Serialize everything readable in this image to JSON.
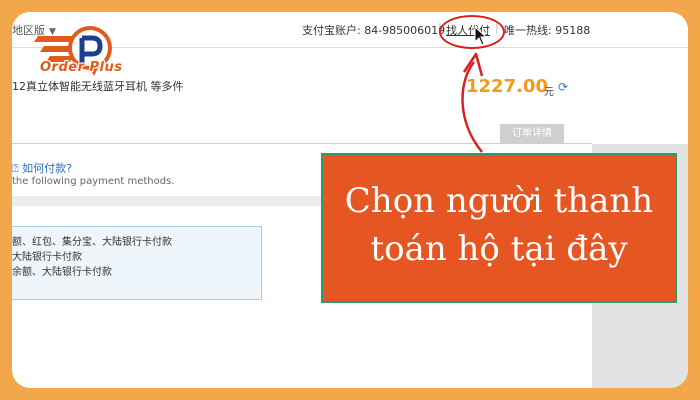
{
  "topbar": {
    "region_label": "地区版",
    "account_label": "支付宝账户: 84-985006019",
    "separator": "|",
    "payer_link": "找人代付",
    "hotline": "唯一热线: 95188"
  },
  "order": {
    "product_name": "12真立体智能无线蓝牙耳机 等多件",
    "price": "1227.00",
    "currency_unit": "元",
    "refresh_icon": "refresh-icon",
    "order_details_tab": "订单详情"
  },
  "payment": {
    "how_to_pay": "如何付款?",
    "methods_intro": "the following payment methods.",
    "methods": [
      "额、红包、集分宝、大陆银行卡付款",
      "大陆银行卡付款",
      "余额、大陆银行卡付款"
    ]
  },
  "callout": {
    "line1": "Chọn người thanh",
    "line2": "toán hộ tại đây"
  },
  "logo": {
    "text": "Order Plus",
    "icon": "order-plus-logo-icon"
  },
  "colors": {
    "background": "#f2a74b",
    "callout_bg": "#e65623",
    "callout_border": "#2f9a6a",
    "annotation_red": "#d9201e",
    "price": "#f29a1c",
    "link_blue": "#2a6fc4"
  }
}
